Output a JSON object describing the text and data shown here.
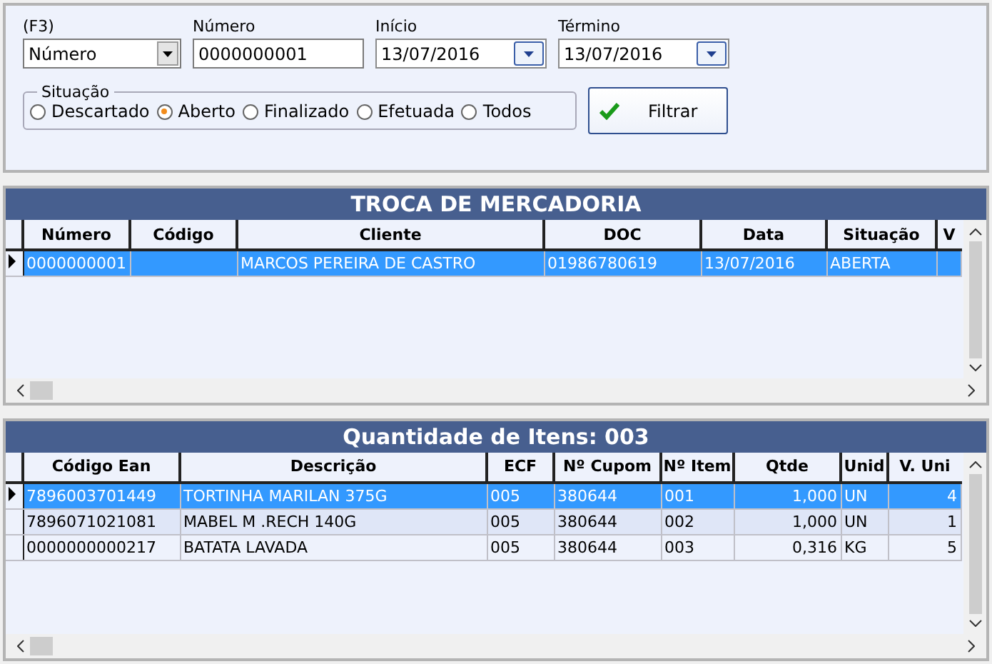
{
  "filter": {
    "search_by": {
      "label": "(F3)",
      "value": "Número"
    },
    "number": {
      "label": "Número",
      "value": "0000000001"
    },
    "start": {
      "label": "Início",
      "value": "13/07/2016"
    },
    "end": {
      "label": "Término",
      "value": "13/07/2016"
    },
    "status": {
      "label": "Situação",
      "options": [
        {
          "label": "Descartado",
          "selected": false
        },
        {
          "label": "Aberto",
          "selected": true
        },
        {
          "label": "Finalizado",
          "selected": false
        },
        {
          "label": "Efetuada",
          "selected": false
        },
        {
          "label": "Todos",
          "selected": false
        }
      ]
    },
    "filter_button": "Filtrar"
  },
  "exchanges": {
    "title": "TROCA DE MERCADORIA",
    "columns": [
      "Número",
      "Código",
      "Cliente",
      "DOC",
      "Data",
      "Situação",
      "V"
    ],
    "rows": [
      {
        "selected": true,
        "cells": [
          "0000000001",
          null,
          "MARCOS PEREIRA DE CASTRO",
          "01986780619",
          "13/07/2016",
          "ABERTA",
          null
        ]
      }
    ]
  },
  "items": {
    "title": "Quantidade de Itens: 003",
    "columns": [
      "Código Ean",
      "Descrição",
      "ECF",
      "Nº Cupom",
      "Nº Item",
      "Qtde",
      "Unid",
      "V. Uni"
    ],
    "rows": [
      {
        "selected": true,
        "cells": [
          "7896003701449",
          "TORTINHA MARILAN 375G",
          "005",
          "380644",
          "001",
          "1,000",
          "UN",
          "4"
        ]
      },
      {
        "selected": false,
        "cells": [
          "7896071021081",
          "MABEL M .RECH  140G",
          "005",
          "380644",
          "002",
          "1,000",
          "UN",
          "1"
        ]
      },
      {
        "selected": false,
        "cells": [
          "0000000000217",
          "BATATA LAVADA",
          "005",
          "380644",
          "003",
          "0,316",
          "KG",
          "5"
        ]
      }
    ]
  }
}
